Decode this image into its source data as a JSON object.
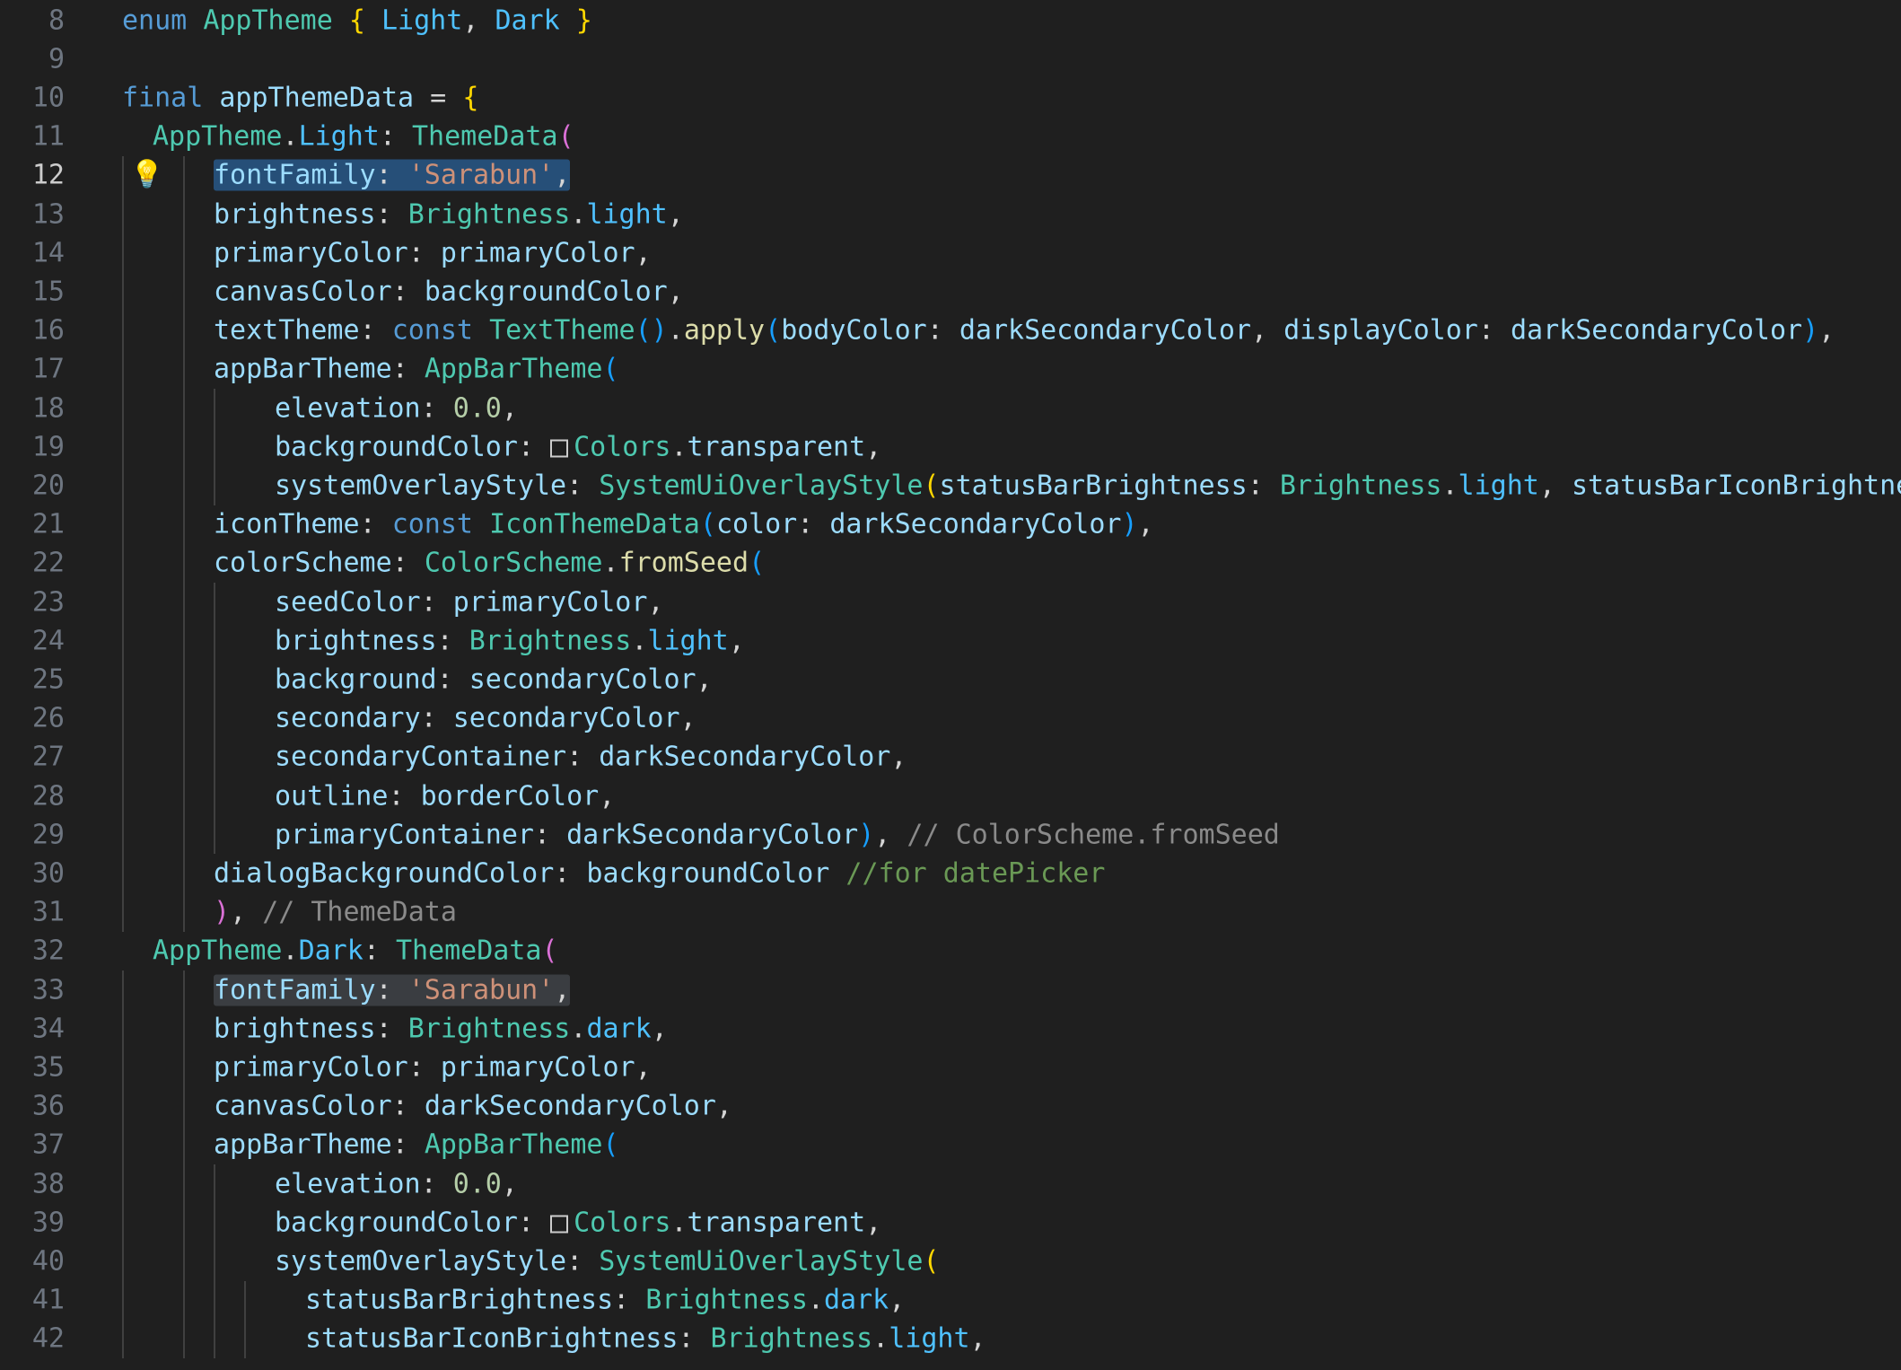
{
  "editor": {
    "language": "dart",
    "active_line": 12,
    "colors": {
      "background": "#1f1f1f",
      "line_number": "#6e7681",
      "active_line_number": "#cccccc",
      "selection": "#264f78",
      "occurrence": "#3a3d41",
      "lightbulb": "#f5c518"
    },
    "icons": {
      "lightbulb": "lightbulb-icon",
      "color_swatch": "color-swatch-icon"
    },
    "lines": [
      {
        "n": "8",
        "indent": 0,
        "tokens": [
          {
            "t": "enum",
            "c": "kw"
          },
          {
            "t": " ",
            "c": "p"
          },
          {
            "t": "AppTheme",
            "c": "type"
          },
          {
            "t": " ",
            "c": "p"
          },
          {
            "t": "{",
            "c": "b1"
          },
          {
            "t": " ",
            "c": "p"
          },
          {
            "t": "Light",
            "c": "prop"
          },
          {
            "t": ", ",
            "c": "p"
          },
          {
            "t": "Dark",
            "c": "prop"
          },
          {
            "t": " ",
            "c": "p"
          },
          {
            "t": "}",
            "c": "b1"
          }
        ]
      },
      {
        "n": "9",
        "indent": 0,
        "tokens": []
      },
      {
        "n": "10",
        "indent": 0,
        "tokens": [
          {
            "t": "final",
            "c": "kw"
          },
          {
            "t": " ",
            "c": "p"
          },
          {
            "t": "appThemeData",
            "c": "var"
          },
          {
            "t": " = ",
            "c": "p"
          },
          {
            "t": "{",
            "c": "b1"
          }
        ]
      },
      {
        "n": "11",
        "indent": 1,
        "tokens": [
          {
            "t": "AppTheme",
            "c": "type"
          },
          {
            "t": ".",
            "c": "p"
          },
          {
            "t": "Light",
            "c": "prop"
          },
          {
            "t": ": ",
            "c": "p"
          },
          {
            "t": "ThemeData",
            "c": "type"
          },
          {
            "t": "(",
            "c": "b2"
          }
        ]
      },
      {
        "n": "12",
        "indent": 3,
        "bulb": true,
        "tokens": [
          {
            "t": "fontFamily: 'Sarabun',",
            "c": "var",
            "hl": "sel",
            "parts": [
              {
                "t": "fontFamily",
                "c": "var"
              },
              {
                "t": ": ",
                "c": "p"
              },
              {
                "t": "'Sarabun'",
                "c": "str"
              },
              {
                "t": ",",
                "c": "p"
              }
            ]
          }
        ]
      },
      {
        "n": "13",
        "indent": 3,
        "tokens": [
          {
            "t": "brightness",
            "c": "var"
          },
          {
            "t": ": ",
            "c": "p"
          },
          {
            "t": "Brightness",
            "c": "type"
          },
          {
            "t": ".",
            "c": "p"
          },
          {
            "t": "light",
            "c": "prop"
          },
          {
            "t": ",",
            "c": "p"
          }
        ]
      },
      {
        "n": "14",
        "indent": 3,
        "tokens": [
          {
            "t": "primaryColor",
            "c": "var"
          },
          {
            "t": ": ",
            "c": "p"
          },
          {
            "t": "primaryColor",
            "c": "var"
          },
          {
            "t": ",",
            "c": "p"
          }
        ]
      },
      {
        "n": "15",
        "indent": 3,
        "tokens": [
          {
            "t": "canvasColor",
            "c": "var"
          },
          {
            "t": ": ",
            "c": "p"
          },
          {
            "t": "backgroundColor",
            "c": "var"
          },
          {
            "t": ",",
            "c": "p"
          }
        ]
      },
      {
        "n": "16",
        "indent": 3,
        "tokens": [
          {
            "t": "textTheme",
            "c": "var"
          },
          {
            "t": ": ",
            "c": "p"
          },
          {
            "t": "const",
            "c": "kw"
          },
          {
            "t": " ",
            "c": "p"
          },
          {
            "t": "TextTheme",
            "c": "type"
          },
          {
            "t": "()",
            "c": "b3"
          },
          {
            "t": ".",
            "c": "p"
          },
          {
            "t": "apply",
            "c": "fn"
          },
          {
            "t": "(",
            "c": "b3"
          },
          {
            "t": "bodyColor",
            "c": "var"
          },
          {
            "t": ": ",
            "c": "p"
          },
          {
            "t": "darkSecondaryColor",
            "c": "var"
          },
          {
            "t": ", ",
            "c": "p"
          },
          {
            "t": "displayColor",
            "c": "var"
          },
          {
            "t": ": ",
            "c": "p"
          },
          {
            "t": "darkSecondaryColor",
            "c": "var"
          },
          {
            "t": ")",
            "c": "b3"
          },
          {
            "t": ",",
            "c": "p"
          }
        ]
      },
      {
        "n": "17",
        "indent": 3,
        "tokens": [
          {
            "t": "appBarTheme",
            "c": "var"
          },
          {
            "t": ": ",
            "c": "p"
          },
          {
            "t": "AppBarTheme",
            "c": "type"
          },
          {
            "t": "(",
            "c": "b3"
          }
        ]
      },
      {
        "n": "18",
        "indent": 4,
        "tokens": [
          {
            "t": "elevation",
            "c": "var"
          },
          {
            "t": ": ",
            "c": "p"
          },
          {
            "t": "0.0",
            "c": "num"
          },
          {
            "t": ",",
            "c": "p"
          }
        ]
      },
      {
        "n": "19",
        "indent": 4,
        "tokens": [
          {
            "t": "backgroundColor",
            "c": "var"
          },
          {
            "t": ": ",
            "c": "p"
          },
          {
            "t": "",
            "c": "swatch"
          },
          {
            "t": "Colors",
            "c": "type"
          },
          {
            "t": ".",
            "c": "p"
          },
          {
            "t": "transparent",
            "c": "var"
          },
          {
            "t": ",",
            "c": "p"
          }
        ]
      },
      {
        "n": "20",
        "indent": 4,
        "tokens": [
          {
            "t": "systemOverlayStyle",
            "c": "var"
          },
          {
            "t": ": ",
            "c": "p"
          },
          {
            "t": "SystemUiOverlayStyle",
            "c": "type"
          },
          {
            "t": "(",
            "c": "b1"
          },
          {
            "t": "statusBarBrightness",
            "c": "var"
          },
          {
            "t": ": ",
            "c": "p"
          },
          {
            "t": "Brightness",
            "c": "type"
          },
          {
            "t": ".",
            "c": "p"
          },
          {
            "t": "light",
            "c": "prop"
          },
          {
            "t": ", ",
            "c": "p"
          },
          {
            "t": "statusBarIconBrightness",
            "c": "var"
          },
          {
            "t": ":",
            "c": "p"
          }
        ]
      },
      {
        "n": "21",
        "indent": 3,
        "tokens": [
          {
            "t": "iconTheme",
            "c": "var"
          },
          {
            "t": ": ",
            "c": "p"
          },
          {
            "t": "const",
            "c": "kw"
          },
          {
            "t": " ",
            "c": "p"
          },
          {
            "t": "IconThemeData",
            "c": "type"
          },
          {
            "t": "(",
            "c": "b3"
          },
          {
            "t": "color",
            "c": "var"
          },
          {
            "t": ": ",
            "c": "p"
          },
          {
            "t": "darkSecondaryColor",
            "c": "var"
          },
          {
            "t": ")",
            "c": "b3"
          },
          {
            "t": ",",
            "c": "p"
          }
        ]
      },
      {
        "n": "22",
        "indent": 3,
        "tokens": [
          {
            "t": "colorScheme",
            "c": "var"
          },
          {
            "t": ": ",
            "c": "p"
          },
          {
            "t": "ColorScheme",
            "c": "type"
          },
          {
            "t": ".",
            "c": "p"
          },
          {
            "t": "fromSeed",
            "c": "fn"
          },
          {
            "t": "(",
            "c": "b3"
          }
        ]
      },
      {
        "n": "23",
        "indent": 4,
        "tokens": [
          {
            "t": "seedColor",
            "c": "var"
          },
          {
            "t": ": ",
            "c": "p"
          },
          {
            "t": "primaryColor",
            "c": "var"
          },
          {
            "t": ",",
            "c": "p"
          }
        ]
      },
      {
        "n": "24",
        "indent": 4,
        "tokens": [
          {
            "t": "brightness",
            "c": "var"
          },
          {
            "t": ": ",
            "c": "p"
          },
          {
            "t": "Brightness",
            "c": "type"
          },
          {
            "t": ".",
            "c": "p"
          },
          {
            "t": "light",
            "c": "prop"
          },
          {
            "t": ",",
            "c": "p"
          }
        ]
      },
      {
        "n": "25",
        "indent": 4,
        "tokens": [
          {
            "t": "background",
            "c": "var"
          },
          {
            "t": ": ",
            "c": "p"
          },
          {
            "t": "secondaryColor",
            "c": "var"
          },
          {
            "t": ",",
            "c": "p"
          }
        ]
      },
      {
        "n": "26",
        "indent": 4,
        "tokens": [
          {
            "t": "secondary",
            "c": "var"
          },
          {
            "t": ": ",
            "c": "p"
          },
          {
            "t": "secondaryColor",
            "c": "var"
          },
          {
            "t": ",",
            "c": "p"
          }
        ]
      },
      {
        "n": "27",
        "indent": 4,
        "tokens": [
          {
            "t": "secondaryContainer",
            "c": "var"
          },
          {
            "t": ": ",
            "c": "p"
          },
          {
            "t": "darkSecondaryColor",
            "c": "var"
          },
          {
            "t": ",",
            "c": "p"
          }
        ]
      },
      {
        "n": "28",
        "indent": 4,
        "tokens": [
          {
            "t": "outline",
            "c": "var"
          },
          {
            "t": ": ",
            "c": "p"
          },
          {
            "t": "borderColor",
            "c": "var"
          },
          {
            "t": ",",
            "c": "p"
          }
        ]
      },
      {
        "n": "29",
        "indent": 4,
        "tokens": [
          {
            "t": "primaryContainer",
            "c": "var"
          },
          {
            "t": ": ",
            "c": "p"
          },
          {
            "t": "darkSecondaryColor",
            "c": "var"
          },
          {
            "t": ")",
            "c": "b3"
          },
          {
            "t": ", ",
            "c": "p"
          },
          {
            "t": "// ColorScheme.fromSeed",
            "c": "cl"
          }
        ]
      },
      {
        "n": "30",
        "indent": 3,
        "tokens": [
          {
            "t": "dialogBackgroundColor",
            "c": "var"
          },
          {
            "t": ": ",
            "c": "p"
          },
          {
            "t": "backgroundColor",
            "c": "var"
          },
          {
            "t": " ",
            "c": "p"
          },
          {
            "t": "//for datePicker",
            "c": "cm"
          }
        ]
      },
      {
        "n": "31",
        "indent": 3,
        "tokens": [
          {
            "t": ")",
            "c": "b2"
          },
          {
            "t": ", ",
            "c": "p"
          },
          {
            "t": "// ThemeData",
            "c": "cl"
          }
        ]
      },
      {
        "n": "32",
        "indent": 1,
        "tokens": [
          {
            "t": "AppTheme",
            "c": "type"
          },
          {
            "t": ".",
            "c": "p"
          },
          {
            "t": "Dark",
            "c": "prop"
          },
          {
            "t": ": ",
            "c": "p"
          },
          {
            "t": "ThemeData",
            "c": "type"
          },
          {
            "t": "(",
            "c": "b2"
          }
        ]
      },
      {
        "n": "33",
        "indent": 3,
        "tokens": [
          {
            "t": "fontFamily: 'Sarabun',",
            "c": "var",
            "hl": "occ",
            "parts": [
              {
                "t": "fontFamily",
                "c": "var"
              },
              {
                "t": ": ",
                "c": "p"
              },
              {
                "t": "'Sarabun'",
                "c": "str"
              },
              {
                "t": ",",
                "c": "p"
              }
            ]
          }
        ]
      },
      {
        "n": "34",
        "indent": 3,
        "tokens": [
          {
            "t": "brightness",
            "c": "var"
          },
          {
            "t": ": ",
            "c": "p"
          },
          {
            "t": "Brightness",
            "c": "type"
          },
          {
            "t": ".",
            "c": "p"
          },
          {
            "t": "dark",
            "c": "prop"
          },
          {
            "t": ",",
            "c": "p"
          }
        ]
      },
      {
        "n": "35",
        "indent": 3,
        "tokens": [
          {
            "t": "primaryColor",
            "c": "var"
          },
          {
            "t": ": ",
            "c": "p"
          },
          {
            "t": "primaryColor",
            "c": "var"
          },
          {
            "t": ",",
            "c": "p"
          }
        ]
      },
      {
        "n": "36",
        "indent": 3,
        "tokens": [
          {
            "t": "canvasColor",
            "c": "var"
          },
          {
            "t": ": ",
            "c": "p"
          },
          {
            "t": "darkSecondaryColor",
            "c": "var"
          },
          {
            "t": ",",
            "c": "p"
          }
        ]
      },
      {
        "n": "37",
        "indent": 3,
        "tokens": [
          {
            "t": "appBarTheme",
            "c": "var"
          },
          {
            "t": ": ",
            "c": "p"
          },
          {
            "t": "AppBarTheme",
            "c": "type"
          },
          {
            "t": "(",
            "c": "b3"
          }
        ]
      },
      {
        "n": "38",
        "indent": 4,
        "tokens": [
          {
            "t": "elevation",
            "c": "var"
          },
          {
            "t": ": ",
            "c": "p"
          },
          {
            "t": "0.0",
            "c": "num"
          },
          {
            "t": ",",
            "c": "p"
          }
        ]
      },
      {
        "n": "39",
        "indent": 4,
        "tokens": [
          {
            "t": "backgroundColor",
            "c": "var"
          },
          {
            "t": ": ",
            "c": "p"
          },
          {
            "t": "",
            "c": "swatch"
          },
          {
            "t": "Colors",
            "c": "type"
          },
          {
            "t": ".",
            "c": "p"
          },
          {
            "t": "transparent",
            "c": "var"
          },
          {
            "t": ",",
            "c": "p"
          }
        ]
      },
      {
        "n": "40",
        "indent": 4,
        "tokens": [
          {
            "t": "systemOverlayStyle",
            "c": "var"
          },
          {
            "t": ": ",
            "c": "p"
          },
          {
            "t": "SystemUiOverlayStyle",
            "c": "type"
          },
          {
            "t": "(",
            "c": "b1"
          }
        ]
      },
      {
        "n": "41",
        "indent": 5,
        "tokens": [
          {
            "t": "statusBarBrightness",
            "c": "var"
          },
          {
            "t": ": ",
            "c": "p"
          },
          {
            "t": "Brightness",
            "c": "type"
          },
          {
            "t": ".",
            "c": "p"
          },
          {
            "t": "dark",
            "c": "prop"
          },
          {
            "t": ",",
            "c": "p"
          }
        ]
      },
      {
        "n": "42",
        "indent": 5,
        "tokens": [
          {
            "t": "statusBarIconBrightness",
            "c": "var"
          },
          {
            "t": ": ",
            "c": "p"
          },
          {
            "t": "Brightness",
            "c": "type"
          },
          {
            "t": ".",
            "c": "p"
          },
          {
            "t": "light",
            "c": "prop"
          },
          {
            "t": ",",
            "c": "p"
          }
        ]
      }
    ]
  }
}
